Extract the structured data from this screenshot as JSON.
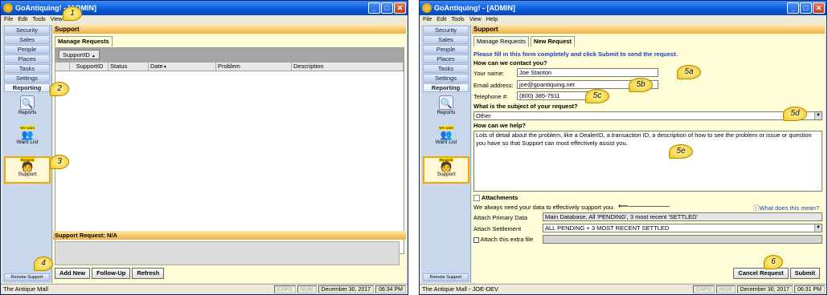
{
  "left": {
    "title": "GoAntiquing! - [ADMIN]",
    "menu": [
      "File",
      "Edit",
      "Tools",
      "View"
    ],
    "nav": [
      "Security",
      "Sales",
      "People",
      "Places",
      "Tasks",
      "Settings",
      "Reporting"
    ],
    "icons": [
      {
        "label": "Reports",
        "badge": ""
      },
      {
        "label": "Want List",
        "badge": "We want"
      },
      {
        "label": "Support",
        "badge": "Request"
      }
    ],
    "remote": "Remote Support",
    "header": "Support",
    "tab": "Manage Requests",
    "group_col": "SupportID",
    "columns": [
      "SupportID",
      "Status",
      "Date",
      "Problem",
      "Description"
    ],
    "request_label": "Support Request: N/A",
    "buttons": [
      "Add New",
      "Follow-Up",
      "Refresh"
    ],
    "status_left": "The Antique Mall",
    "caps": "CAPS",
    "num": "NUM",
    "date": "December 30, 2017",
    "time": "06:34 PM"
  },
  "right": {
    "title": "GoAntiquing! - [ADMIN]",
    "menu": [
      "File",
      "Edit",
      "Tools",
      "View",
      "Help"
    ],
    "tabs": [
      "Manage Requests",
      "New Request"
    ],
    "instruction": "Please fill in this form completely and click Submit to send the request.",
    "contact_heading": "How can we contact you?",
    "name_label": "Your name:",
    "name_value": "Joe Stanton",
    "email_label": "Email address:",
    "email_value": "joe@goantiquing.net",
    "phone_label": "Telephone #:",
    "phone_value": "(800) 385-7911",
    "subject_heading": "What is the subject of your request?",
    "subject_value": "Other",
    "help_heading": "How can we help?",
    "help_text": "Lots of detail about the problem, like a DealerID, a transaction ID, a description of how to see the problem or issue or question you have so that Support can most effectively assist you.",
    "attachments_heading": "Attachments",
    "attach_note": "We always need your data to effectively support you.",
    "what_link": "What does this mean?",
    "attach_primary_label": "Attach Primary Data",
    "attach_primary_value": "Main Database, All 'PENDING', 3 most recent 'SETTLED'",
    "attach_settlement_label": "Attach Settlement",
    "attach_settlement_value": "ALL PENDING + 3 MOST RECENT SETTLED",
    "extra_file_label": "Attach this extra file",
    "cancel_label": "Cancel Request",
    "submit_label": "Submit",
    "status_left": "The Antique Mall - JOE-DEV",
    "date": "December 30, 2017",
    "time": "06:31 PM"
  },
  "callouts": [
    "1",
    "2",
    "3",
    "4",
    "5a",
    "5b",
    "5c",
    "5d",
    "5e",
    "6"
  ]
}
